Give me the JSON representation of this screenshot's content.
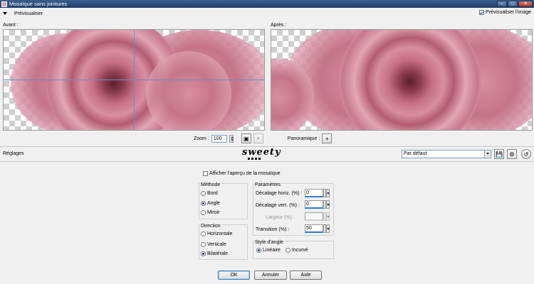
{
  "window": {
    "title": "Mosaïque sans jointures"
  },
  "preview_bar": {
    "toggle_label": "Prévisualiser",
    "preview_image_label": "Prévisualiser l'image",
    "preview_image_checked": true
  },
  "panels": {
    "before_label": "Avant :",
    "after_label": "Après :"
  },
  "zoom": {
    "label": "Zoom :",
    "value": "100",
    "pan_label": "Panoramique :",
    "pan_symbol": "+"
  },
  "settings_bar": {
    "label": "Réglages",
    "logo_text": "sweety",
    "preset_value": "Par défaut"
  },
  "mosaic_preview": {
    "label": "Afficher l'aperçu de la mosaïque",
    "checked": false
  },
  "method": {
    "title": "Méthode",
    "options": [
      {
        "label": "Bord",
        "selected": false
      },
      {
        "label": "Angle",
        "selected": true
      },
      {
        "label": "Miroir",
        "selected": false
      }
    ]
  },
  "direction": {
    "title": "Direction",
    "options": [
      {
        "label": "Horizontale",
        "selected": false
      },
      {
        "label": "Verticale",
        "selected": false
      },
      {
        "label": "Bilatérale",
        "selected": true
      }
    ]
  },
  "parameters": {
    "title": "Paramètres",
    "fields": [
      {
        "label": "Décalage horiz. (%) :",
        "value": "0",
        "enabled": true
      },
      {
        "label": "Décalage vert. (%) :",
        "value": "0",
        "enabled": true
      },
      {
        "label": "Largeur (%) :",
        "value": "",
        "enabled": false
      },
      {
        "label": "Transition (%) :",
        "value": "50",
        "enabled": true
      }
    ]
  },
  "corner_style": {
    "title": "Style d'angle",
    "options": [
      {
        "label": "Linéaire",
        "selected": true
      },
      {
        "label": "Incurvé",
        "selected": false
      }
    ]
  },
  "buttons": {
    "ok": "OK",
    "cancel": "Annuler",
    "help": "Aide"
  },
  "colors": {
    "titlebar": "#1d3d66",
    "rose": "#c56f86",
    "accent": "#2f7ad8"
  }
}
